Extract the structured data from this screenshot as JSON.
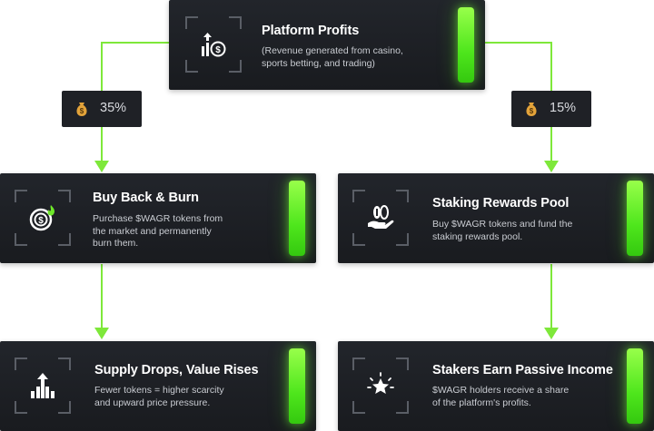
{
  "colors": {
    "accent": "#6ee82a",
    "card": "#1c1e22",
    "text": "#ffffff",
    "subtext": "#c9ccd2"
  },
  "top": {
    "title": "Platform Profits",
    "desc": [
      "(Revenue generated from casino,",
      "sports betting, and trading)"
    ],
    "icon": "revenue-growth-icon"
  },
  "splits": {
    "left": {
      "value": "35%",
      "icon": "money-bag-icon"
    },
    "right": {
      "value": "15%",
      "icon": "money-bag-icon"
    }
  },
  "left_mid": {
    "title": "Buy Back & Burn",
    "desc": [
      "Purchase $WAGR tokens from",
      "the market and permanently",
      "burn them."
    ],
    "icon": "coin-burn-icon"
  },
  "right_mid": {
    "title": "Staking Rewards Pool",
    "desc": [
      "Buy $WAGR tokens and fund the",
      "staking rewards pool."
    ],
    "icon": "hand-coins-icon"
  },
  "left_bottom": {
    "title": "Supply Drops, Value Rises",
    "desc": [
      "Fewer tokens = higher scarcity",
      "and upward price pressure."
    ],
    "icon": "bar-chart-up-icon"
  },
  "right_bottom": {
    "title": "Stakers Earn Passive Income",
    "desc": [
      "$WAGR holders receive a share",
      "of the platform's profits."
    ],
    "icon": "star-burst-icon"
  }
}
